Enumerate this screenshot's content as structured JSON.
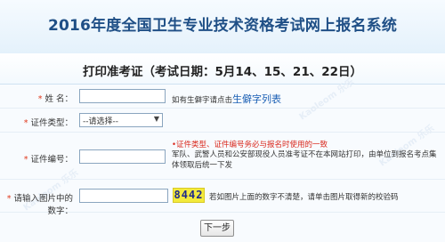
{
  "header": {
    "title": "2016年度全国卫生专业技术资格考试网上报名系统"
  },
  "subheader": {
    "title": "打印准考证（考试日期：5月14、15、21、22日）"
  },
  "form": {
    "name_row": {
      "required": "*",
      "label": "姓  名：",
      "input_value": "",
      "hint": "如有生僻字请点击",
      "hint_link": "生僻字列表"
    },
    "id_type_row": {
      "required": "*",
      "label": "证件类型：",
      "select_value": "--请选择--"
    },
    "id_number_row": {
      "required": "*",
      "label": "证件编号：",
      "input_value": "",
      "warning": "•证件类型、证件编号务必与报名时使用的一致",
      "note": "军队、武警人员和公安部现役人员准考证不在本网站打印，由单位到报名考点集体领取后统一下发"
    },
    "captcha_row": {
      "required": "*",
      "label": "请输入图片中的数字：",
      "input_value": "",
      "captcha": "8442",
      "hint": "若如图片上面的数字不清楚，请单击图片取得新的校验码"
    },
    "next_button": "下一步"
  },
  "watermark": {
    "text": "Kaoleom 乐乐"
  },
  "colors": {
    "title": "#1f4f86",
    "required": "#e03a1e",
    "warning": "#d9271b",
    "link": "#1a5fb4"
  }
}
